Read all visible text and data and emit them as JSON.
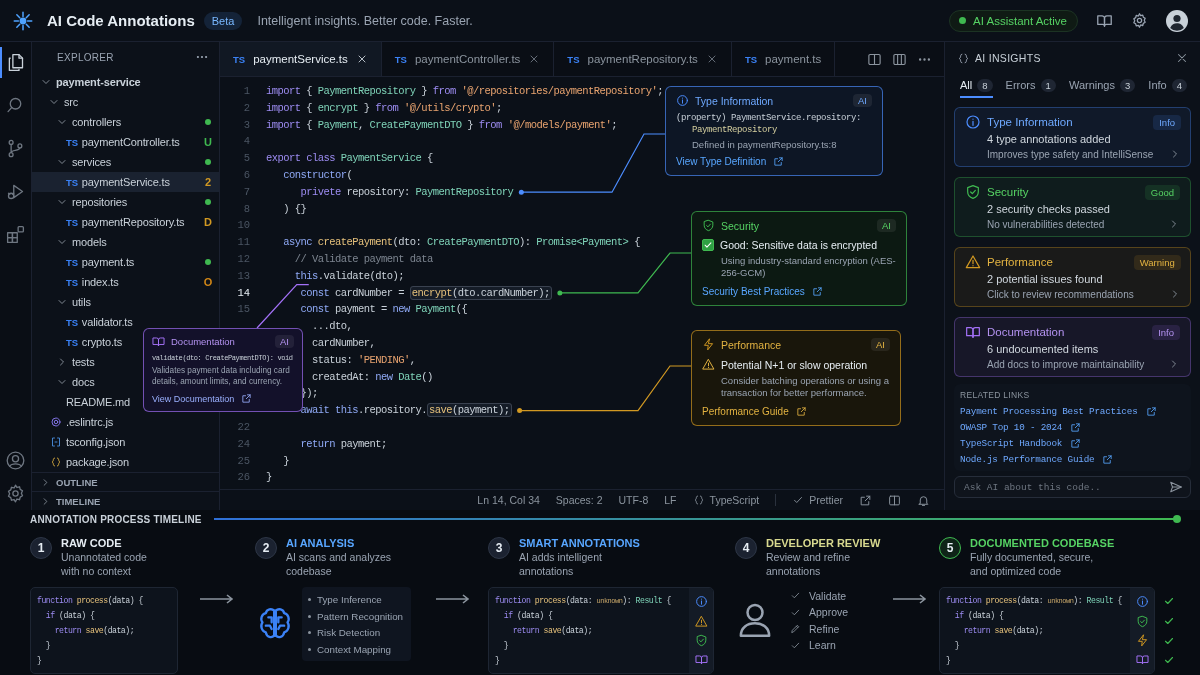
{
  "header": {
    "title": "AI Code Annotations",
    "badge": "Beta",
    "tagline": "Intelligent insights. Better code. Faster.",
    "status": {
      "label": "AI Assistant Active",
      "active": true
    }
  },
  "activity_bar": {
    "items": [
      {
        "kind": "files",
        "selected": true
      },
      {
        "kind": "search",
        "selected": false
      },
      {
        "kind": "source_control",
        "selected": false
      },
      {
        "kind": "run",
        "selected": false
      },
      {
        "kind": "extensions",
        "selected": false
      }
    ],
    "bottom": [
      {
        "kind": "account"
      },
      {
        "kind": "settings"
      }
    ]
  },
  "explorer": {
    "title": "EXPLORER",
    "tree": [
      {
        "kind": "folder",
        "name": "payment-service",
        "expanded": true,
        "selected": false,
        "children": [
          {
            "kind": "folder",
            "name": "src",
            "expanded": true,
            "selected": false,
            "children": [
              {
                "kind": "folder",
                "name": "controllers",
                "expanded": true,
                "selected": false,
                "color": "#3fb950",
                "children": [
                  {
                    "kind": "ts",
                    "tag": "TS",
                    "name": "paymentController.ts",
                    "selected": false,
                    "status": "U",
                    "color": "#3fb950"
                  }
                ]
              },
              {
                "kind": "folder",
                "name": "services",
                "expanded": true,
                "selected": false,
                "color": "#3fb950",
                "children": [
                  {
                    "kind": "ts",
                    "tag": "TS",
                    "name": "paymentService.ts",
                    "selected": true,
                    "status": "2",
                    "color": "#d29922"
                  }
                ]
              },
              {
                "kind": "folder",
                "name": "repositories",
                "expanded": true,
                "selected": false,
                "color": "#3fb950",
                "children": [
                  {
                    "kind": "ts",
                    "tag": "TS",
                    "name": "paymentRepository.ts",
                    "selected": false,
                    "status": "D",
                    "color": "#d29922"
                  }
                ]
              },
              {
                "kind": "folder",
                "name": "models",
                "expanded": true,
                "selected": false,
                "children": [
                  {
                    "kind": "ts",
                    "tag": "TS",
                    "name": "payment.ts",
                    "selected": false,
                    "color": "#3fb950"
                  },
                  {
                    "kind": "ts",
                    "tag": "TS",
                    "name": "index.ts",
                    "selected": false,
                    "status": "O",
                    "color": "#d18616"
                  }
                ]
              },
              {
                "kind": "folder",
                "name": "utils",
                "expanded": true,
                "selected": false,
                "children": [
                  {
                    "kind": "ts",
                    "tag": "TS",
                    "name": "validator.ts",
                    "selected": false
                  },
                  {
                    "kind": "ts",
                    "tag": "TS",
                    "name": "crypto.ts",
                    "selected": false
                  }
                ]
              },
              {
                "kind": "folder",
                "name": "tests",
                "expanded": false,
                "selected": false
              },
              {
                "kind": "folder",
                "name": "docs",
                "expanded": true,
                "selected": false,
                "children": [
                  {
                    "kind": "md",
                    "name": "README.md",
                    "selected": false
                  }
                ]
              }
            ]
          },
          {
            "kind": "eslint",
            "name": ".eslintrc.js",
            "selected": false
          },
          {
            "kind": "tsconfig",
            "name": "tsconfig.json",
            "selected": false
          },
          {
            "kind": "json",
            "name": "package.json",
            "selected": false
          }
        ]
      }
    ],
    "sections": [
      {
        "label": "OUTLINE",
        "expanded": false
      },
      {
        "label": "TIMELINE",
        "expanded": false
      }
    ]
  },
  "editor": {
    "tabs": [
      {
        "tag": "TS",
        "label": "paymentService.ts",
        "selected": true,
        "closable": true
      },
      {
        "tag": "TS",
        "label": "paymentController.ts",
        "selected": false,
        "closable": true
      },
      {
        "tag": "TS",
        "label": "paymentRepository.ts",
        "selected": false,
        "closable": true
      },
      {
        "tag": "TS",
        "label": "payment.ts",
        "selected": false,
        "closable": false
      }
    ],
    "lines": [
      {
        "number": "1",
        "current": false,
        "tokens": [
          {
            "kind": "kw",
            "text": "import"
          },
          {
            "kind": "txt",
            "text": " { "
          },
          {
            "kind": "type",
            "text": "PaymentRepository"
          },
          {
            "kind": "txt",
            "text": " } "
          },
          {
            "kind": "kw",
            "text": "from "
          },
          {
            "kind": "str",
            "text": "'@/repositories/paymentRepository'"
          },
          {
            "kind": "txt",
            "text": ";"
          }
        ]
      },
      {
        "number": "2",
        "current": false,
        "tokens": [
          {
            "kind": "kw",
            "text": "import"
          },
          {
            "kind": "txt",
            "text": " { "
          },
          {
            "kind": "type",
            "text": "encrypt"
          },
          {
            "kind": "txt",
            "text": " } "
          },
          {
            "kind": "kw",
            "text": "from "
          },
          {
            "kind": "str",
            "text": "'@/utils/crypto'"
          },
          {
            "kind": "txt",
            "text": ";"
          }
        ]
      },
      {
        "number": "3",
        "current": false,
        "tokens": [
          {
            "kind": "kw",
            "text": "import"
          },
          {
            "kind": "txt",
            "text": " { "
          },
          {
            "kind": "type",
            "text": "Payment"
          },
          {
            "kind": "txt",
            "text": ", "
          },
          {
            "kind": "type",
            "text": "CreatePaymentDTO"
          },
          {
            "kind": "txt",
            "text": " } "
          },
          {
            "kind": "kw",
            "text": "from "
          },
          {
            "kind": "str",
            "text": "'@/models/payment'"
          },
          {
            "kind": "txt",
            "text": ";"
          }
        ]
      },
      {
        "number": "4",
        "current": false
      },
      {
        "number": "5",
        "current": false,
        "tokens": [
          {
            "kind": "kw",
            "text": "export class "
          },
          {
            "kind": "type",
            "text": "PaymentService"
          },
          {
            "kind": "txt",
            "text": " {"
          }
        ]
      },
      {
        "number": "6",
        "current": false,
        "tokens": [
          {
            "kind": "self",
            "text": "   constructor"
          },
          {
            "kind": "txt",
            "text": "("
          }
        ]
      },
      {
        "number": "7",
        "current": false,
        "tokens": [
          {
            "kind": "kw",
            "text": "      privete"
          },
          {
            "kind": "txt",
            "text": " repository: "
          },
          {
            "kind": "type",
            "text": "PaymentRepository"
          }
        ]
      },
      {
        "number": "8",
        "current": false,
        "tokens": [
          {
            "kind": "txt",
            "text": "   ) {}"
          }
        ]
      },
      {
        "number": "10",
        "current": false
      },
      {
        "number": "11",
        "current": false,
        "tokens": [
          {
            "kind": "self",
            "text": "   async "
          },
          {
            "kind": "fn",
            "text": "createPayment"
          },
          {
            "kind": "txt",
            "text": "(dto: "
          },
          {
            "kind": "type",
            "text": "CreatePaymentDTO"
          },
          {
            "kind": "txt",
            "text": "): "
          },
          {
            "kind": "type",
            "text": "Promise<Payment>"
          },
          {
            "kind": "txt",
            "text": " {"
          }
        ]
      },
      {
        "number": "12",
        "current": false,
        "tokens": [
          {
            "kind": "cmt",
            "text": "     // Validate payment data"
          }
        ]
      },
      {
        "number": "13",
        "current": false,
        "tokens": [
          {
            "kind": "self",
            "text": "     this"
          },
          {
            "kind": "txt",
            "text": ".validate(dto);"
          }
        ]
      },
      {
        "number": "14",
        "current": true,
        "tokens": [
          {
            "kind": "self",
            "text": "      const"
          },
          {
            "kind": "txt",
            "text": " cardNumber = "
          },
          {
            "kind": "box",
            "tokens": [
              {
                "kind": "fn",
                "text": "encrypt"
              },
              {
                "kind": "txt",
                "text": "(dto.cardNumber);"
              }
            ]
          }
        ]
      },
      {
        "number": "15",
        "current": false,
        "tokens": [
          {
            "kind": "self",
            "text": "      const"
          },
          {
            "kind": "txt",
            "text": " payment = "
          },
          {
            "kind": "self",
            "text": "new "
          },
          {
            "kind": "type",
            "text": "Payment"
          },
          {
            "kind": "txt",
            "text": "({"
          }
        ]
      },
      {
        "tokens": [
          {
            "kind": "txt",
            "text": "        ...dto,"
          }
        ]
      },
      {
        "tokens": [
          {
            "kind": "txt",
            "text": "        cardNumber,"
          }
        ]
      },
      {
        "tokens": [
          {
            "kind": "txt",
            "text": "        status: "
          },
          {
            "kind": "str",
            "text": "'PENDING'"
          },
          {
            "kind": "txt",
            "text": ","
          }
        ]
      },
      {
        "tokens": [
          {
            "kind": "txt",
            "text": "        createdAt: "
          },
          {
            "kind": "self",
            "text": "new "
          },
          {
            "kind": "type",
            "text": "Date"
          },
          {
            "kind": "txt",
            "text": "()"
          }
        ]
      },
      {
        "tokens": [
          {
            "kind": "txt",
            "text": "      });"
          }
        ]
      },
      {
        "tokens": [
          {
            "kind": "self",
            "text": "      await this"
          },
          {
            "kind": "txt",
            "text": ".repository."
          },
          {
            "kind": "box",
            "tokens": [
              {
                "kind": "fn",
                "text": "save"
              },
              {
                "kind": "txt",
                "text": "(payment);"
              }
            ]
          }
        ]
      },
      {
        "number": "22",
        "current": false
      },
      {
        "number": "24",
        "current": false,
        "tokens": [
          {
            "kind": "self",
            "text": "      return"
          },
          {
            "kind": "txt",
            "text": " payment;"
          }
        ]
      },
      {
        "number": "25",
        "current": false,
        "tokens": [
          {
            "kind": "txt",
            "text": "   }"
          }
        ]
      },
      {
        "number": "26",
        "current": false,
        "tokens": [
          {
            "kind": "txt",
            "text": "}"
          }
        ]
      }
    ],
    "annotations": [
      {
        "kind": "type",
        "title": "Type Information",
        "badge": "AI",
        "signature": [
          "(property) PaymentService.repository:",
          "PaymentRepository"
        ],
        "note": "Defined in paymentRepository.ts:8",
        "link": "View Type Definition"
      },
      {
        "kind": "security",
        "title": "Security",
        "badge": "AI",
        "headline": "Good: Sensitive data is encrypted",
        "checked": true,
        "detail": "Using industry-standard encryption (AES-256-GCM)",
        "link": "Security Best Practices"
      },
      {
        "kind": "documentation",
        "title": "Documentation",
        "badge": "AI",
        "signature": [
          "validate(dto: CreatePaymentDTO): void"
        ],
        "detail": "Validates payment data including card details, amount limits, and currency.",
        "link": "View Documentation"
      },
      {
        "kind": "performance",
        "title": "Performance",
        "badge": "AI",
        "headline": "Potential N+1 or slow operation",
        "detail": "Consider batching operations or using a transaction for better performance.",
        "link": "Performance Guide"
      }
    ],
    "status_bar": [
      {
        "kind": "text",
        "text": "Ln 14, Col 34"
      },
      {
        "kind": "text",
        "text": "Spaces: 2"
      },
      {
        "kind": "text",
        "text": "UTF-8"
      },
      {
        "kind": "text",
        "text": "LF"
      },
      {
        "kind": "language",
        "text": "TypeScript"
      },
      {
        "kind": "formatter",
        "text": "Prettier"
      },
      {
        "kind": "share"
      },
      {
        "kind": "layout"
      },
      {
        "kind": "bell"
      }
    ]
  },
  "insights": {
    "title": "AI INSIGHTS",
    "tabs": [
      {
        "label": "All",
        "count": "8",
        "selected": true
      },
      {
        "label": "Errors",
        "count": "1",
        "selected": false
      },
      {
        "label": "Warnings",
        "count": "3",
        "selected": false
      },
      {
        "label": "Info",
        "count": "4",
        "selected": false
      }
    ],
    "cards": [
      {
        "kind": "info",
        "title": "Type Information",
        "badge": "Info",
        "summary": "4 type annotations added",
        "detail": "Improves type safety and IntelliSense"
      },
      {
        "kind": "security",
        "title": "Security",
        "badge": "Good",
        "summary": "2 security checks passed",
        "detail": "No vulnerabilities detected"
      },
      {
        "kind": "warning",
        "title": "Performance",
        "badge": "Warning",
        "summary": "2 potential issues found",
        "detail": "Click to review recommendations"
      },
      {
        "kind": "documentation",
        "title": "Documentation",
        "badge": "Info",
        "summary": "6 undocumented items",
        "detail": "Add docs to improve maintainability"
      }
    ],
    "related_links": {
      "title": "RELATED LINKS",
      "links": [
        "Payment Processing Best Practices",
        "OWASP Top 10 - 2024",
        "TypeScript Handbook",
        "Node.js Performance Guide"
      ]
    },
    "ask": {
      "placeholder": "Ask AI about this code.."
    }
  },
  "timeline": {
    "title": "ANNOTATION PROCESS TIMELINE",
    "steps": [
      {
        "number": "1",
        "title": "RAW CODE",
        "description": "Unannotated code with no context",
        "color": "#e6edf3",
        "completed": false,
        "kind": "code",
        "arrow_after": true,
        "code": [
          {
            "tokens": [
              {
                "kind": "kw",
                "text": "function "
              },
              {
                "kind": "fn",
                "text": "process"
              },
              {
                "kind": "txt",
                "text": "(data) {"
              }
            ]
          },
          {
            "tokens": [
              {
                "kind": "kw",
                "text": "  if"
              },
              {
                "kind": "txt",
                "text": " (data) {"
              }
            ]
          },
          {
            "tokens": [
              {
                "kind": "kw",
                "text": "    return "
              },
              {
                "kind": "fn",
                "text": "save"
              },
              {
                "kind": "txt",
                "text": "(data);"
              }
            ]
          },
          {
            "tokens": [
              {
                "kind": "txt",
                "text": "  }"
              }
            ]
          },
          {
            "tokens": [
              {
                "kind": "txt",
                "text": "}"
              }
            ]
          }
        ]
      },
      {
        "number": "2",
        "title": "AI ANALYSIS",
        "description": "AI scans and analyzes codebase",
        "color": "#58a6ff",
        "completed": false,
        "kind": "analysis",
        "arrow_after": true,
        "items": [
          "Type Inference",
          "Pattern Recognition",
          "Risk Detection",
          "Context Mapping"
        ]
      },
      {
        "number": "3",
        "title": "SMART ANNOTATIONS",
        "description": "AI adds intelligent annotations",
        "color": "#58a6ff",
        "completed": false,
        "kind": "code",
        "arrow_after": false,
        "code": [
          {
            "tokens": [
              {
                "kind": "kw",
                "text": "function "
              },
              {
                "kind": "fn",
                "text": "process"
              },
              {
                "kind": "txt",
                "text": "(data: "
              },
              {
                "kind": "hint",
                "text": "unknown"
              },
              {
                "kind": "txt",
                "text": "): "
              },
              {
                "kind": "type",
                "text": "Result"
              },
              {
                "kind": "txt",
                "text": " {"
              }
            ]
          },
          {
            "tokens": [
              {
                "kind": "kw",
                "text": "  if"
              },
              {
                "kind": "txt",
                "text": " (data) {"
              }
            ]
          },
          {
            "tokens": [
              {
                "kind": "kw",
                "text": "    return "
              },
              {
                "kind": "fn",
                "text": "save"
              },
              {
                "kind": "txt",
                "text": "(data);"
              }
            ]
          },
          {
            "tokens": [
              {
                "kind": "txt",
                "text": "  }"
              }
            ]
          },
          {
            "tokens": [
              {
                "kind": "txt",
                "text": "}"
              }
            ]
          }
        ],
        "markers": [
          {
            "kind": "info"
          },
          {
            "kind": "warning"
          },
          {
            "kind": "security"
          },
          {
            "kind": "documentation"
          }
        ]
      },
      {
        "number": "4",
        "title": "DEVELOPER REVIEW",
        "description": "Review and refine annotations",
        "color": "#d8d98f",
        "completed": false,
        "kind": "review",
        "arrow_after": true,
        "items": [
          {
            "kind": "check",
            "text": "Validate"
          },
          {
            "kind": "check",
            "text": "Approve"
          },
          {
            "kind": "edit",
            "text": "Refine"
          },
          {
            "kind": "check",
            "text": "Learn"
          }
        ]
      },
      {
        "number": "5",
        "title": "DOCUMENTED CODEBASE",
        "description": "Fully documented, secure, and optimized code",
        "color": "#56d364",
        "completed": true,
        "kind": "code",
        "code": [
          {
            "tokens": [
              {
                "kind": "kw",
                "text": "function "
              },
              {
                "kind": "fn",
                "text": "process"
              },
              {
                "kind": "txt",
                "text": "(data: "
              },
              {
                "kind": "hint",
                "text": "unknown"
              },
              {
                "kind": "txt",
                "text": "): "
              },
              {
                "kind": "type",
                "text": "Result"
              },
              {
                "kind": "txt",
                "text": " {"
              }
            ]
          },
          {
            "tokens": [
              {
                "kind": "kw",
                "text": "  if"
              },
              {
                "kind": "txt",
                "text": " (data) {"
              }
            ]
          },
          {
            "tokens": [
              {
                "kind": "kw",
                "text": "    return "
              },
              {
                "kind": "fn",
                "text": "save"
              },
              {
                "kind": "txt",
                "text": "(data);"
              }
            ]
          },
          {
            "tokens": [
              {
                "kind": "txt",
                "text": "  }"
              }
            ]
          },
          {
            "tokens": [
              {
                "kind": "txt",
                "text": "}"
              }
            ]
          }
        ],
        "markers": [
          {
            "kind": "info",
            "verified": true
          },
          {
            "kind": "security",
            "verified": true
          },
          {
            "kind": "performance",
            "verified": true
          },
          {
            "kind": "documentation",
            "verified": true
          }
        ]
      }
    ]
  }
}
